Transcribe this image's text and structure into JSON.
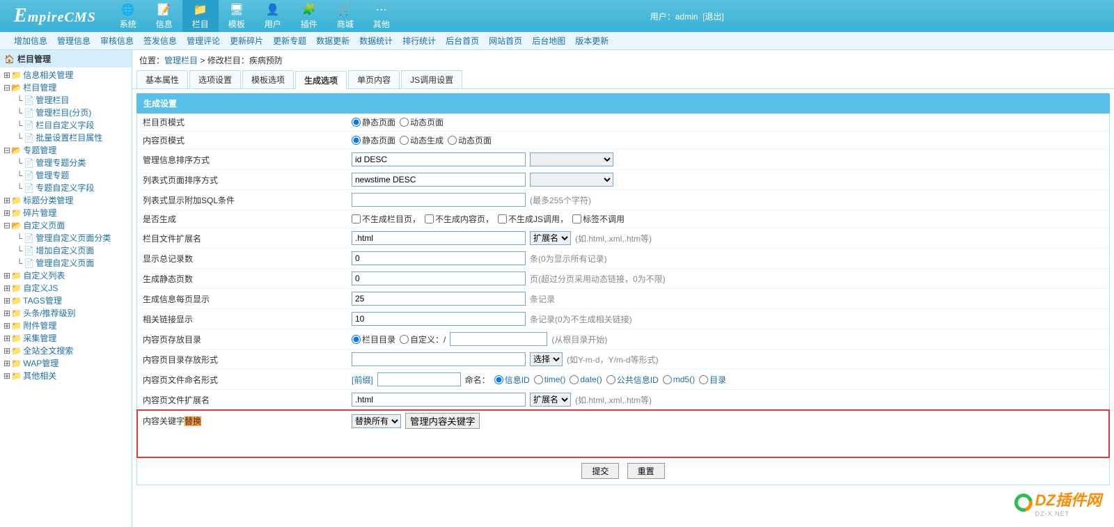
{
  "logo": "EmpireCMS",
  "topnav": [
    {
      "label": "系统",
      "icon": "🌐"
    },
    {
      "label": "信息",
      "icon": "📝"
    },
    {
      "label": "栏目",
      "icon": "📁",
      "active": true
    },
    {
      "label": "模板",
      "icon": "🖥"
    },
    {
      "label": "用户",
      "icon": "👤"
    },
    {
      "label": "插件",
      "icon": "🧩"
    },
    {
      "label": "商城",
      "icon": "🛒"
    },
    {
      "label": "其他",
      "icon": "⋯"
    }
  ],
  "user_label": "用户：",
  "user_name": "admin",
  "logout": "[退出]",
  "subnav": [
    "增加信息",
    "管理信息",
    "审核信息",
    "签发信息",
    "管理评论",
    "更新碎片",
    "更新专题",
    "数据更新",
    "数据统计",
    "排行统计",
    "后台首页",
    "网站首页",
    "后台地图",
    "版本更新"
  ],
  "side_title": "栏目管理",
  "tree": [
    {
      "label": "信息相关管理",
      "icon": "📁",
      "exp": "+"
    },
    {
      "label": "栏目管理",
      "icon": "📂",
      "exp": "-",
      "children": [
        {
          "label": "管理栏目",
          "icon": "📄"
        },
        {
          "label": "管理栏目(分页)",
          "icon": "📄"
        },
        {
          "label": "栏目自定义字段",
          "icon": "📄"
        },
        {
          "label": "批量设置栏目属性",
          "icon": "📄"
        }
      ]
    },
    {
      "label": "专题管理",
      "icon": "📂",
      "exp": "-",
      "children": [
        {
          "label": "管理专题分类",
          "icon": "📄"
        },
        {
          "label": "管理专题",
          "icon": "📄"
        },
        {
          "label": "专题自定义字段",
          "icon": "📄"
        }
      ]
    },
    {
      "label": "标题分类管理",
      "icon": "📁",
      "exp": "+"
    },
    {
      "label": "碎片管理",
      "icon": "📁",
      "exp": "+"
    },
    {
      "label": "自定义页面",
      "icon": "📂",
      "exp": "-",
      "children": [
        {
          "label": "管理自定义页面分类",
          "icon": "📄"
        },
        {
          "label": "增加自定义页面",
          "icon": "📄"
        },
        {
          "label": "管理自定义页面",
          "icon": "📄"
        }
      ]
    },
    {
      "label": "自定义列表",
      "icon": "📁",
      "exp": "+"
    },
    {
      "label": "自定义JS",
      "icon": "📁",
      "exp": "+"
    },
    {
      "label": "TAGS管理",
      "icon": "📁",
      "exp": "+"
    },
    {
      "label": "头条/推荐级别",
      "icon": "📁",
      "exp": "+"
    },
    {
      "label": "附件管理",
      "icon": "📁",
      "exp": "+"
    },
    {
      "label": "采集管理",
      "icon": "📁",
      "exp": "+"
    },
    {
      "label": "全站全文搜索",
      "icon": "📁",
      "exp": "+"
    },
    {
      "label": "WAP管理",
      "icon": "📁",
      "exp": "+"
    },
    {
      "label": "其他相关",
      "icon": "📁",
      "exp": "+"
    }
  ],
  "crumb": {
    "prefix": "位置：",
    "a": "管理栏目",
    "sep": " > ",
    "b": "修改栏目：疾病预防"
  },
  "tabs": [
    "基本属性",
    "选项设置",
    "模板选项",
    "生成选项",
    "单页内容",
    "JS调用设置"
  ],
  "active_tab_index": 3,
  "panel_title": "生成设置",
  "f": {
    "page_mode": {
      "label": "栏目页模式",
      "opt1": "静态页面",
      "opt2": "动态页面"
    },
    "content_mode": {
      "label": "内容页模式",
      "opt1": "静态页面",
      "opt2": "动态生成",
      "opt3": "动态页面"
    },
    "order1": {
      "label": "管理信息排序方式",
      "value": "id DESC"
    },
    "order2": {
      "label": "列表式页面排序方式",
      "value": "newstime DESC"
    },
    "sql": {
      "label": "列表式显示附加SQL条件",
      "hint": "(最多255个字符)"
    },
    "gen": {
      "label": "是否生成",
      "c1": "不生成栏目页，",
      "c2": "不生成内容页，",
      "c3": "不生成JS调用，",
      "c4": "标签不调用"
    },
    "ext": {
      "label": "栏目文件扩展名",
      "value": ".html",
      "sel": "扩展名",
      "hint": "(如.html,.xml,.htm等)"
    },
    "total": {
      "label": "显示总记录数",
      "value": "0",
      "hint": "条(0为显示所有记录)"
    },
    "static": {
      "label": "生成静态页数",
      "value": "0",
      "hint": "页(超过分页采用动态链接，0为不限)"
    },
    "perpage": {
      "label": "生成信息每页显示",
      "value": "25",
      "hint": "条记录"
    },
    "related": {
      "label": "相关链接显示",
      "value": "10",
      "hint": "条记录(0为不生成相关链接)"
    },
    "dir": {
      "label": "内容页存放目录",
      "opt1": "栏目目录",
      "opt2": "自定义：/",
      "hint": "(从根目录开始)"
    },
    "storefmt": {
      "label": "内容页目录存放形式",
      "sel": "选择",
      "hint": "(如Y-m-d，Y/m-d等形式)"
    },
    "naming": {
      "label": "内容页文件命名形式",
      "prefix_lbl": "[前缀]",
      "name_lbl": "命名：",
      "r1": "信息ID",
      "r2": "time()",
      "r3": "date()",
      "r4": "公共信息ID",
      "r5": "md5()",
      "r6": "目录"
    },
    "cext": {
      "label": "内容页文件扩展名",
      "value": ".html",
      "sel": "扩展名",
      "hint": "(如.html,.xml,.htm等)"
    },
    "kw": {
      "label_a": "内容关键字",
      "label_b": "替换",
      "sel": "替换所有",
      "btn": "管理内容关键字"
    }
  },
  "submit": "提交",
  "reset": "重置",
  "watermark": {
    "text": "DZ插件网",
    "sub": "DZ-X.NET"
  }
}
